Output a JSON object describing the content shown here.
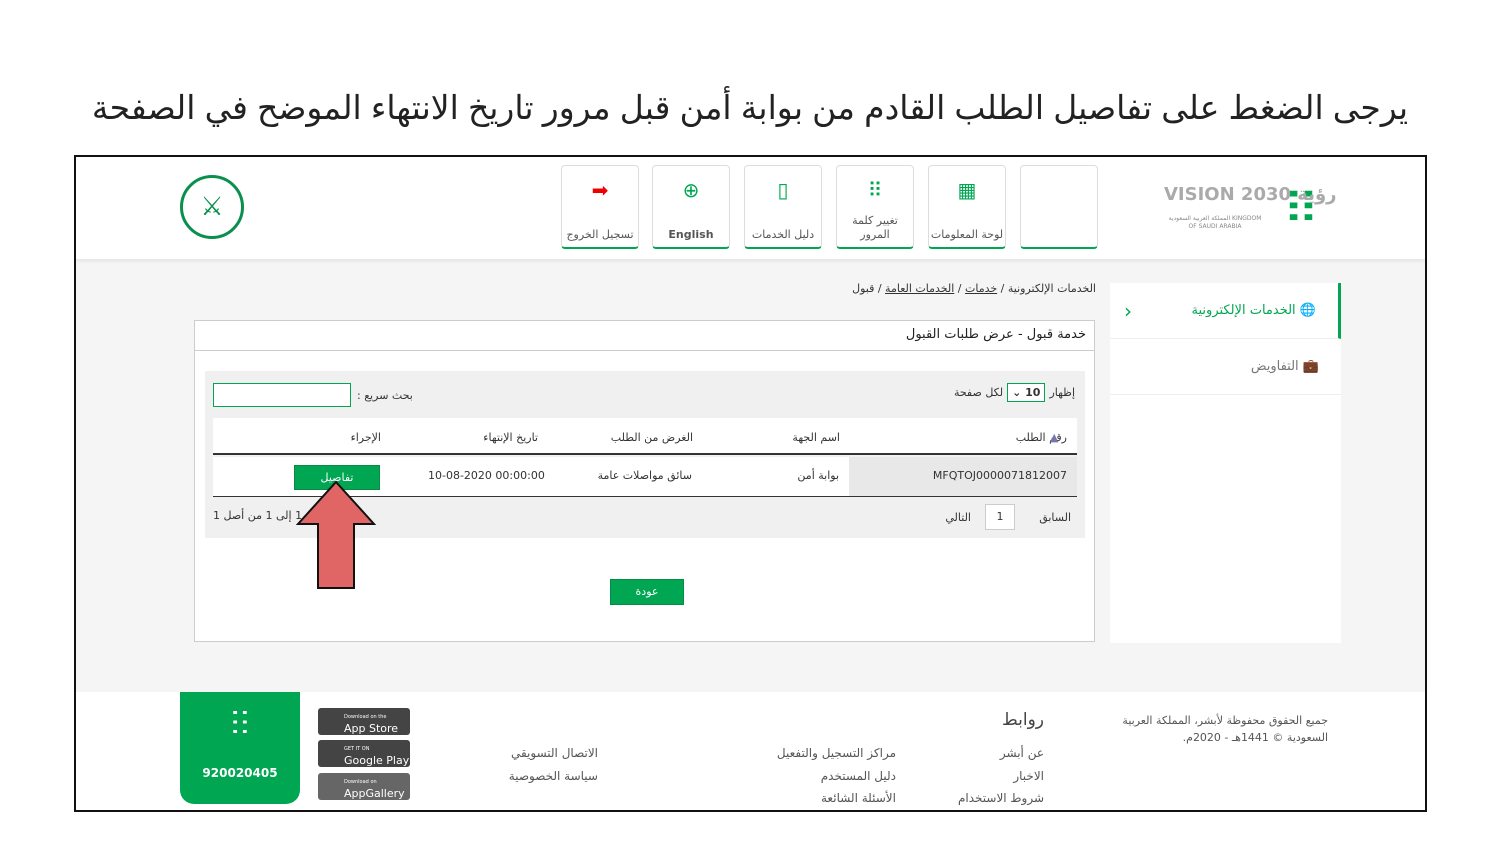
{
  "instruction": "يرجى الضغط على تفاصيل الطلب القادم من بوابة أمن قبل مرور تاريخ الانتهاء الموضح في الصفحة",
  "header": {
    "logo": "أبشر",
    "vision": "VISION رؤية 2030",
    "vision_sub": "المملكة العربية السعودية KINGDOM OF SAUDI ARABIA",
    "tiles": [
      {
        "label": "لوحة المعلومات",
        "icon": "dashboard-icon"
      },
      {
        "label": "تغيير كلمة المرور",
        "icon": "keypad-hand-icon"
      },
      {
        "label": "دليل الخدمات",
        "icon": "book-icon"
      },
      {
        "label": "English",
        "icon": "globe-icon"
      },
      {
        "label": "تسجيل الخروج",
        "icon": "logout-icon"
      }
    ]
  },
  "sidebar": {
    "items": [
      {
        "label": "الخدمات الإلكترونية",
        "icon": "globe-hand-icon"
      },
      {
        "label": "التفاويض",
        "icon": "briefcase-icon"
      }
    ]
  },
  "breadcrumb": [
    "الخدمات الإلكترونية",
    "خدمات",
    "الخدمات العامة",
    "قبول"
  ],
  "panel": {
    "title": "خدمة قبول - عرض طلبات القبول",
    "show": "إظهار",
    "per_page_value": "10",
    "per_page": "لكل صفحة",
    "search_label": "بحث سريع :",
    "search_value": "",
    "columns": [
      "رقم الطلب",
      "اسم الجهة",
      "الغرض من الطلب",
      "تاريخ الإنتهاء",
      "الإجراء"
    ],
    "rows": [
      {
        "id": "MFQTOJ0000071812007",
        "entity": "بوابة أمن",
        "purpose": "سائق مواصلات عامة",
        "expiry": "10-08-2020 00:00:00",
        "action": "تفاصيل"
      }
    ],
    "prev": "السابق",
    "page": "1",
    "next": "التالي",
    "records": "السجلات 1 إلى 1 من أصل 1",
    "back": "عودة"
  },
  "footer": {
    "copyright": "جميع الحقوق محفوظة لأبشر، المملكة العربية السعودية © 1441هـ - 2020م.",
    "links_title": "روابط",
    "col1": [
      "عن أبشر",
      "الاخبار",
      "شروط الاستخدام"
    ],
    "col2": [
      "مراكز التسجيل والتفعيل",
      "دليل المستخدم",
      "الأسئلة الشائعة"
    ],
    "col3": [
      "الاتصال التسويقي",
      "سياسة الخصوصية"
    ],
    "stores": [
      {
        "small": "Download on the",
        "name": "App Store"
      },
      {
        "small": "GET IT ON",
        "name": "Google Play"
      },
      {
        "small": "Download on",
        "name": "AppGallery"
      }
    ],
    "phone": "920020405",
    "brand_logo": "أبشر"
  },
  "colors": {
    "accent": "#00a651",
    "arrow": "#e06666"
  }
}
